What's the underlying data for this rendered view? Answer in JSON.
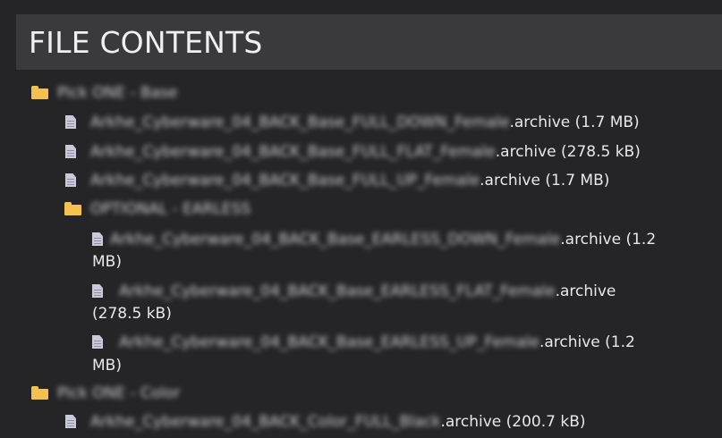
{
  "header": {
    "title": "FILE CONTENTS"
  },
  "tree": {
    "folder1": {
      "label": "Pick ONE - Base",
      "icon": "folder-icon",
      "files": [
        {
          "name": "Arkhe_Cyberware_04_BACK_Base_FULL_DOWN_Female",
          "ext": ".archive",
          "size": "(1.7 MB)",
          "icon": "file-icon"
        },
        {
          "name": "Arkhe_Cyberware_04_BACK_Base_FULL_FLAT_Female",
          "ext": ".archive",
          "size": "(278.5 kB)",
          "icon": "file-icon"
        },
        {
          "name": "Arkhe_Cyberware_04_BACK_Base_FULL_UP_Female",
          "ext": ".archive",
          "size": "(1.7 MB)",
          "icon": "file-icon"
        }
      ],
      "subfolder": {
        "label": "OPTIONAL - EARLESS",
        "icon": "folder-icon",
        "files": [
          {
            "name": "Arkhe_Cyberware_04_BACK_Base_EARLESS_DOWN_Female",
            "ext": ".archive",
            "size_part1": "(1.2",
            "size_part2": "MB)",
            "icon": "file-icon"
          },
          {
            "name": "Arkhe_Cyberware_04_BACK_Base_EARLESS_FLAT_Female",
            "ext": ".archive",
            "size_part2": "(278.5 kB)",
            "icon": "file-icon"
          },
          {
            "name": "Arkhe_Cyberware_04_BACK_Base_EARLESS_UP_Female",
            "ext": ".archive",
            "size_part1": "(1.2",
            "size_part2": "MB)",
            "icon": "file-icon"
          }
        ]
      }
    },
    "folder2": {
      "label": "Pick ONE - Color",
      "icon": "folder-icon",
      "files": [
        {
          "name": "Arkhe_Cyberware_04_BACK_Color_FULL_Black",
          "ext": ".archive",
          "size": "(200.7 kB)",
          "icon": "file-icon"
        }
      ]
    }
  },
  "colors": {
    "background": "#252528",
    "header_background": "#3a3a3d",
    "folder": "#f2c14e",
    "file": "#c9c9d8",
    "text": "#e8e8e8"
  }
}
